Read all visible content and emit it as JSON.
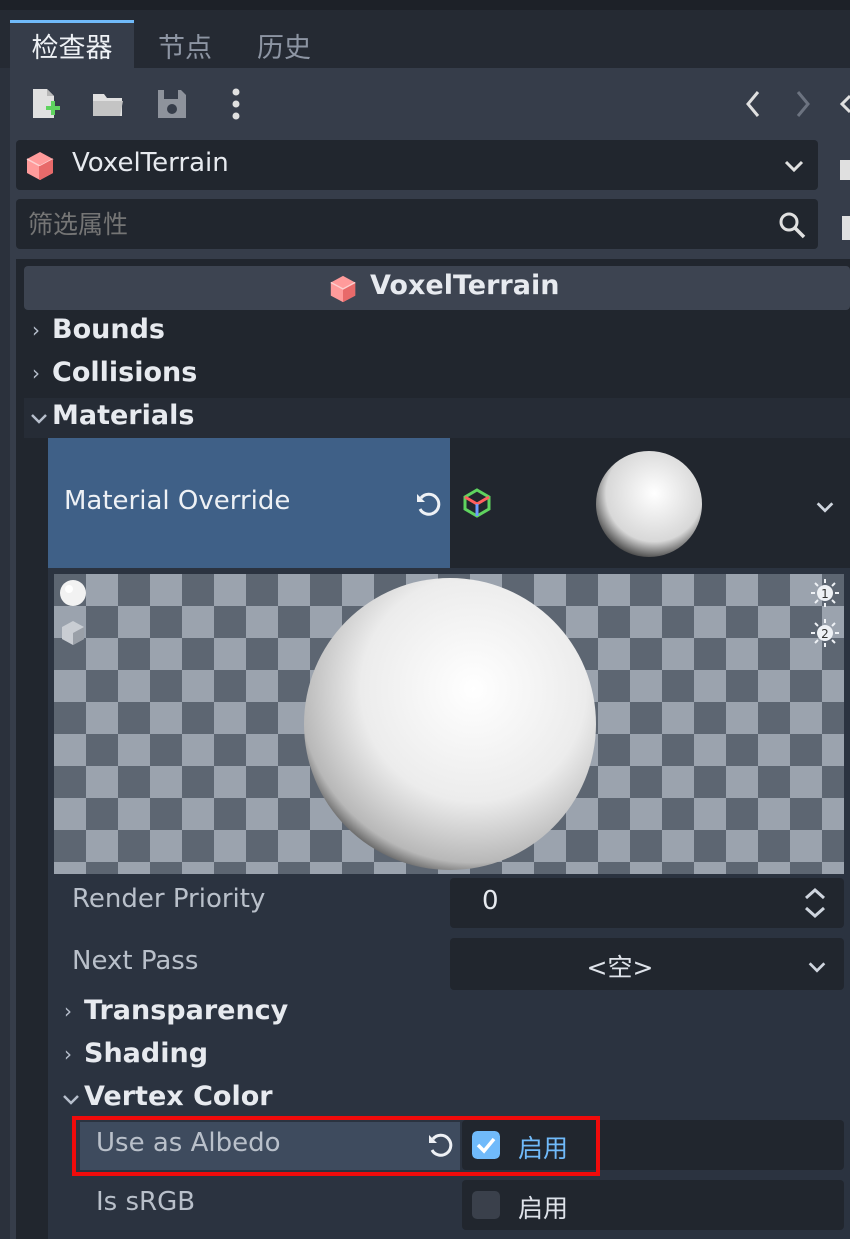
{
  "tabs": [
    {
      "label": "检查器",
      "active": true
    },
    {
      "label": "节点",
      "active": false
    },
    {
      "label": "历史",
      "active": false
    }
  ],
  "toolbar": {
    "icons": [
      "new-resource-icon",
      "open-folder-icon",
      "save-icon",
      "more-menu-icon",
      "back-arrow-icon",
      "forward-arrow-icon"
    ]
  },
  "object_selector": {
    "name": "VoxelTerrain",
    "icon": "cube-icon"
  },
  "filter": {
    "placeholder": "筛选属性"
  },
  "inspector": {
    "header_title": "VoxelTerrain",
    "sections": {
      "bounds": "Bounds",
      "collisions": "Collisions",
      "materials": "Materials"
    },
    "material_override": {
      "label": "Material Override",
      "render_priority": {
        "label": "Render Priority",
        "value": "0"
      },
      "next_pass": {
        "label": "Next Pass",
        "value": "<空>"
      },
      "subsections": {
        "transparency": "Transparency",
        "shading": "Shading",
        "vertex_color": "Vertex Color"
      },
      "use_as_albedo": {
        "label": "Use as Albedo",
        "checked": true,
        "text": "启用"
      },
      "is_srgb": {
        "label": "Is sRGB",
        "checked": false,
        "text": "启用"
      }
    }
  },
  "colors": {
    "accent": "#70bafa",
    "highlight_box": "#f00b0b",
    "selected_row": "#3f6087"
  }
}
